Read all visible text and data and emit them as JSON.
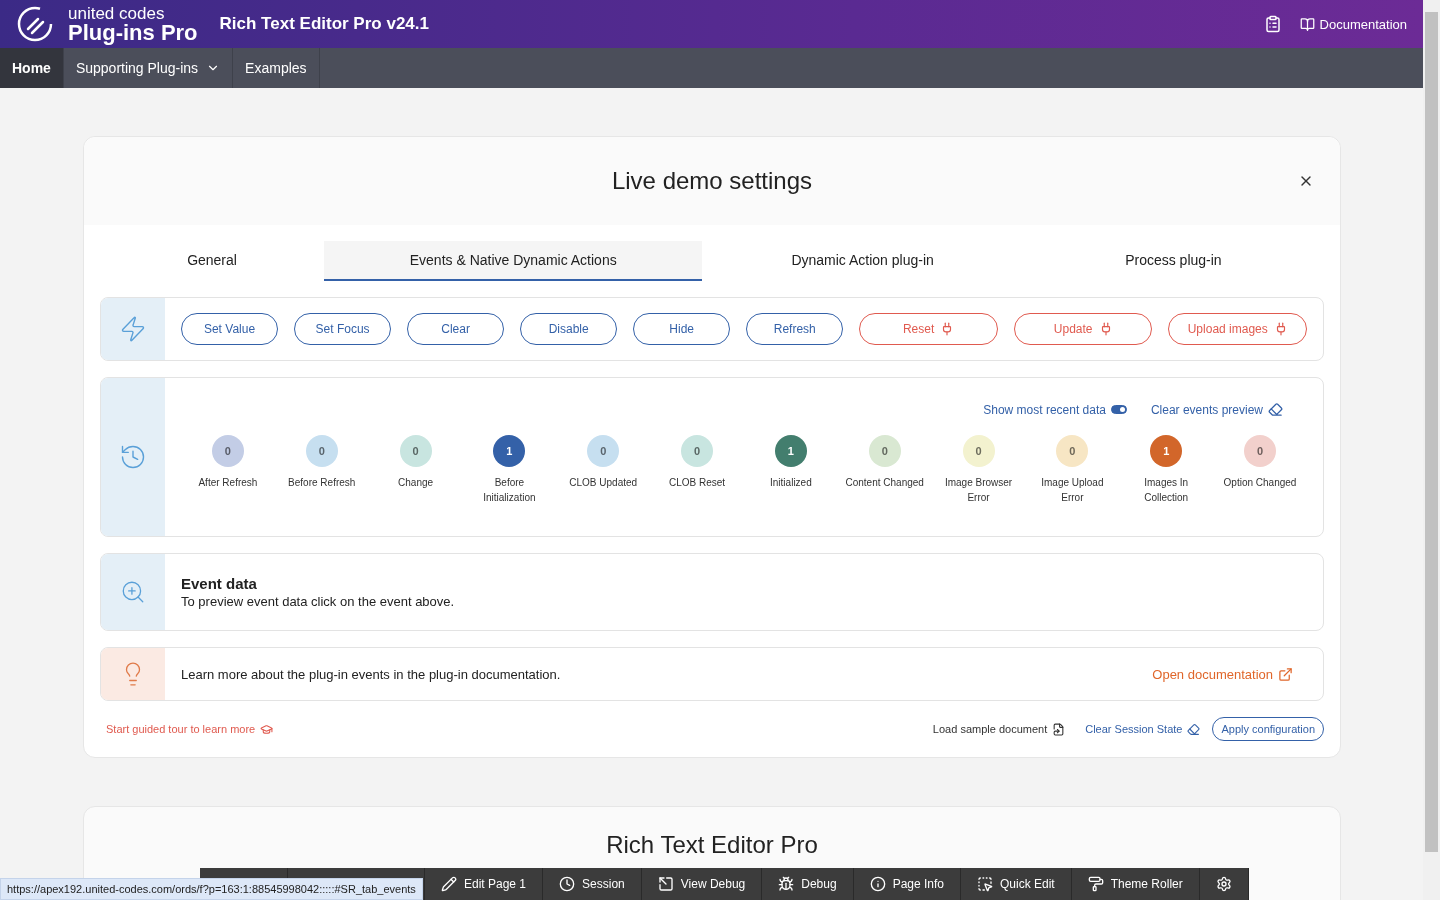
{
  "header": {
    "brand_top": "united codes",
    "brand_bottom": "Plug-ins Pro",
    "title": "Rich Text Editor Pro v24.1",
    "doc_link": "Documentation"
  },
  "nav": [
    {
      "label": "Home",
      "selected": true,
      "dropdown": false
    },
    {
      "label": "Supporting Plug-ins",
      "selected": false,
      "dropdown": true
    },
    {
      "label": "Examples",
      "selected": false,
      "dropdown": false
    }
  ],
  "settings": {
    "title": "Live demo settings",
    "tabs": [
      {
        "label": "General",
        "selected": false
      },
      {
        "label": "Events & Native Dynamic Actions",
        "selected": true
      },
      {
        "label": "Dynamic Action plug-in",
        "selected": false
      },
      {
        "label": "Process plug-in",
        "selected": false
      }
    ],
    "actions": [
      {
        "label": "Set Value",
        "kind": "native"
      },
      {
        "label": "Set Focus",
        "kind": "native"
      },
      {
        "label": "Clear",
        "kind": "native"
      },
      {
        "label": "Disable",
        "kind": "native"
      },
      {
        "label": "Hide",
        "kind": "native"
      },
      {
        "label": "Refresh",
        "kind": "native"
      },
      {
        "label": "Reset",
        "kind": "plugin"
      },
      {
        "label": "Update",
        "kind": "plugin"
      },
      {
        "label": "Upload images",
        "kind": "plugin"
      }
    ],
    "events_toolbar": {
      "toggle_label": "Show most recent data",
      "toggle_on": true,
      "clear_label": "Clear events preview"
    },
    "events": [
      {
        "label": "After Refresh",
        "count": "0",
        "color": "#c3cde6"
      },
      {
        "label": "Before Refresh",
        "count": "0",
        "color": "#c6dff0"
      },
      {
        "label": "Change",
        "count": "0",
        "color": "#c8e5e0"
      },
      {
        "label": "Before Initialization",
        "count": "1",
        "color": "#3461a8"
      },
      {
        "label": "CLOB Updated",
        "count": "0",
        "color": "#c6dff0"
      },
      {
        "label": "CLOB Reset",
        "count": "0",
        "color": "#c8e5e0"
      },
      {
        "label": "Initialized",
        "count": "1",
        "color": "#437e6e"
      },
      {
        "label": "Content Changed",
        "count": "0",
        "color": "#d9e8d2"
      },
      {
        "label": "Image Browser Error",
        "count": "0",
        "color": "#f3f2cf"
      },
      {
        "label": "Image Upload Error",
        "count": "0",
        "color": "#f7e6c4"
      },
      {
        "label": "Images In Collection",
        "count": "1",
        "color": "#d2662a"
      },
      {
        "label": "Option Changed",
        "count": "0",
        "color": "#f2d0cc"
      }
    ],
    "event_data": {
      "title": "Event data",
      "text": "To preview event data click on the event above."
    },
    "learn_more": {
      "text": "Learn more about the plug-in events in the plug-in documentation.",
      "link": "Open documentation"
    },
    "footer": {
      "tour": "Start guided tour to learn more",
      "load_sample": "Load sample document",
      "clear_session": "Clear Session State",
      "apply": "Apply configuration"
    }
  },
  "second_card": {
    "title": "Rich Text Editor Pro"
  },
  "dev_toolbar": [
    {
      "label": "Edit Page 1"
    },
    {
      "label": "Session"
    },
    {
      "label": "View Debug"
    },
    {
      "label": "Debug"
    },
    {
      "label": "Page Info"
    },
    {
      "label": "Quick Edit"
    },
    {
      "label": "Theme Roller"
    }
  ],
  "status_url": "https://apex192.united-codes.com/ords/f?p=163:1:88545998042:::::#SR_tab_events"
}
